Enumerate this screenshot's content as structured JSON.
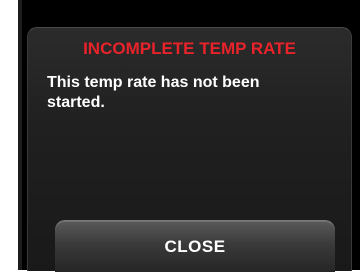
{
  "dialog": {
    "title": "INCOMPLETE TEMP RATE",
    "message": "This temp rate has not been started.",
    "close_label": "CLOSE"
  },
  "colors": {
    "title": "#e8232a",
    "background": "#000000",
    "text": "#ffffff"
  }
}
